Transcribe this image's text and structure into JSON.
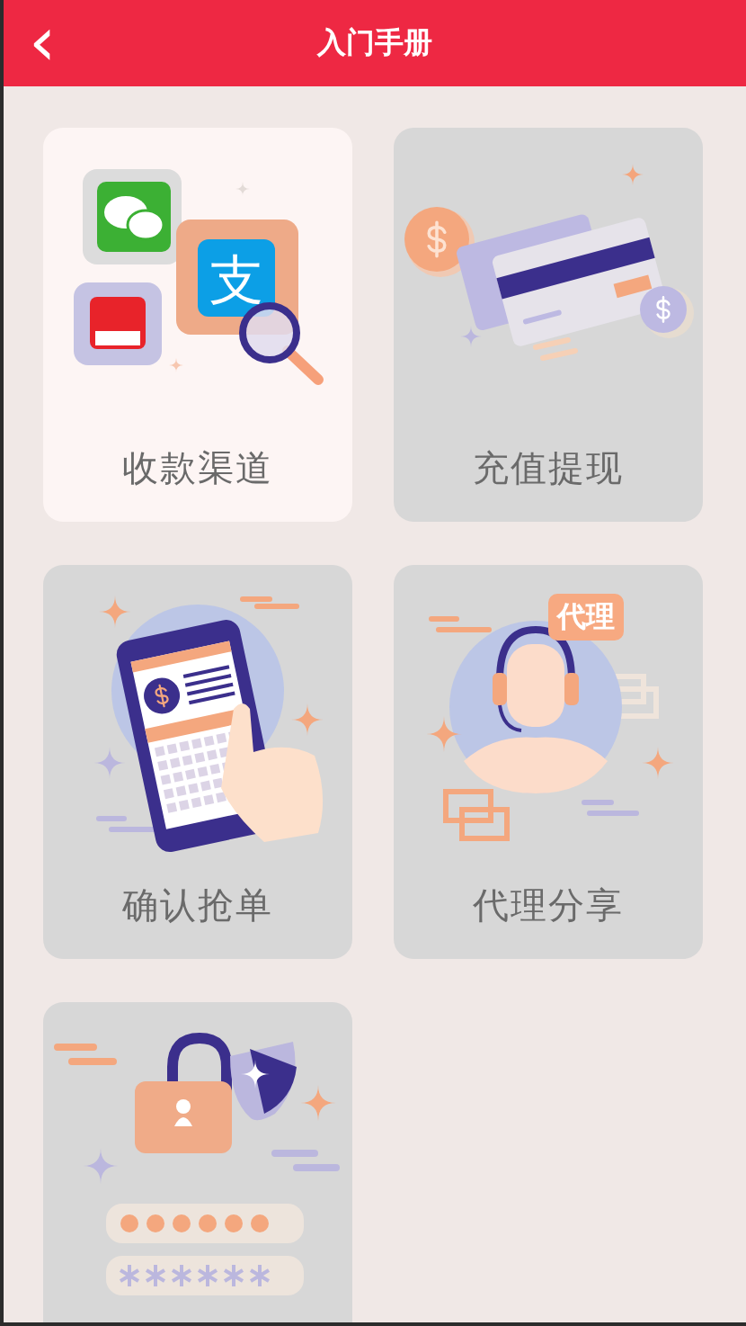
{
  "header": {
    "back_icon": "‹",
    "title": "入门手册"
  },
  "cards": [
    {
      "kind": "payment-apps",
      "label": "收款渠道",
      "selected": true,
      "logo_glyph": "支"
    },
    {
      "kind": "bank-cards",
      "label": "充值提现",
      "selected": false
    },
    {
      "kind": "phone-order",
      "label": "确认抢单",
      "selected": false
    },
    {
      "kind": "agent",
      "label": "代理分享",
      "selected": false,
      "badge": "代理"
    },
    {
      "kind": "security",
      "selected": false
    }
  ]
}
